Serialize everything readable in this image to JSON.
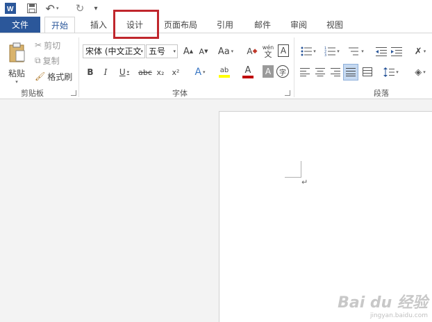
{
  "qat": {
    "word_icon": "W",
    "save_icon": "save-icon",
    "undo_icon": "↶",
    "redo_icon": "↻",
    "customize_icon": "▾"
  },
  "tabs": [
    {
      "label": "文件"
    },
    {
      "label": "开始"
    },
    {
      "label": "插入"
    },
    {
      "label": "设计"
    },
    {
      "label": "页面布局"
    },
    {
      "label": "引用"
    },
    {
      "label": "邮件"
    },
    {
      "label": "审阅"
    },
    {
      "label": "视图"
    }
  ],
  "clipboard": {
    "paste": "粘贴",
    "cut": "剪切",
    "copy": "复制",
    "format_painter": "格式刷",
    "group_label": "剪贴板"
  },
  "font": {
    "font_name": "宋体 (中文正文",
    "font_size": "五号",
    "grow": "A",
    "shrink": "A",
    "change_case": "Aa",
    "clear_format": "A",
    "pinyin_top": "wén",
    "pinyin_bottom": "文",
    "char_border": "A",
    "bold": "B",
    "italic": "I",
    "underline": "U",
    "strike": "abc",
    "subscript": "x₂",
    "superscript": "x²",
    "text_effect": "A",
    "highlight": "ab",
    "font_color": "A",
    "char_shading": "A",
    "enclosed": "字",
    "group_label": "字体"
  },
  "paragraph": {
    "group_label": "段落",
    "para_mark": "↵"
  },
  "colors": {
    "file_tab_bg": "#2b579a",
    "highlight_border": "#c0262c",
    "highlight_color": "#ffff00",
    "font_color": "#c00000"
  },
  "watermark": {
    "main": "Bai du 经验",
    "sub": "jingyan.baidu.com"
  }
}
